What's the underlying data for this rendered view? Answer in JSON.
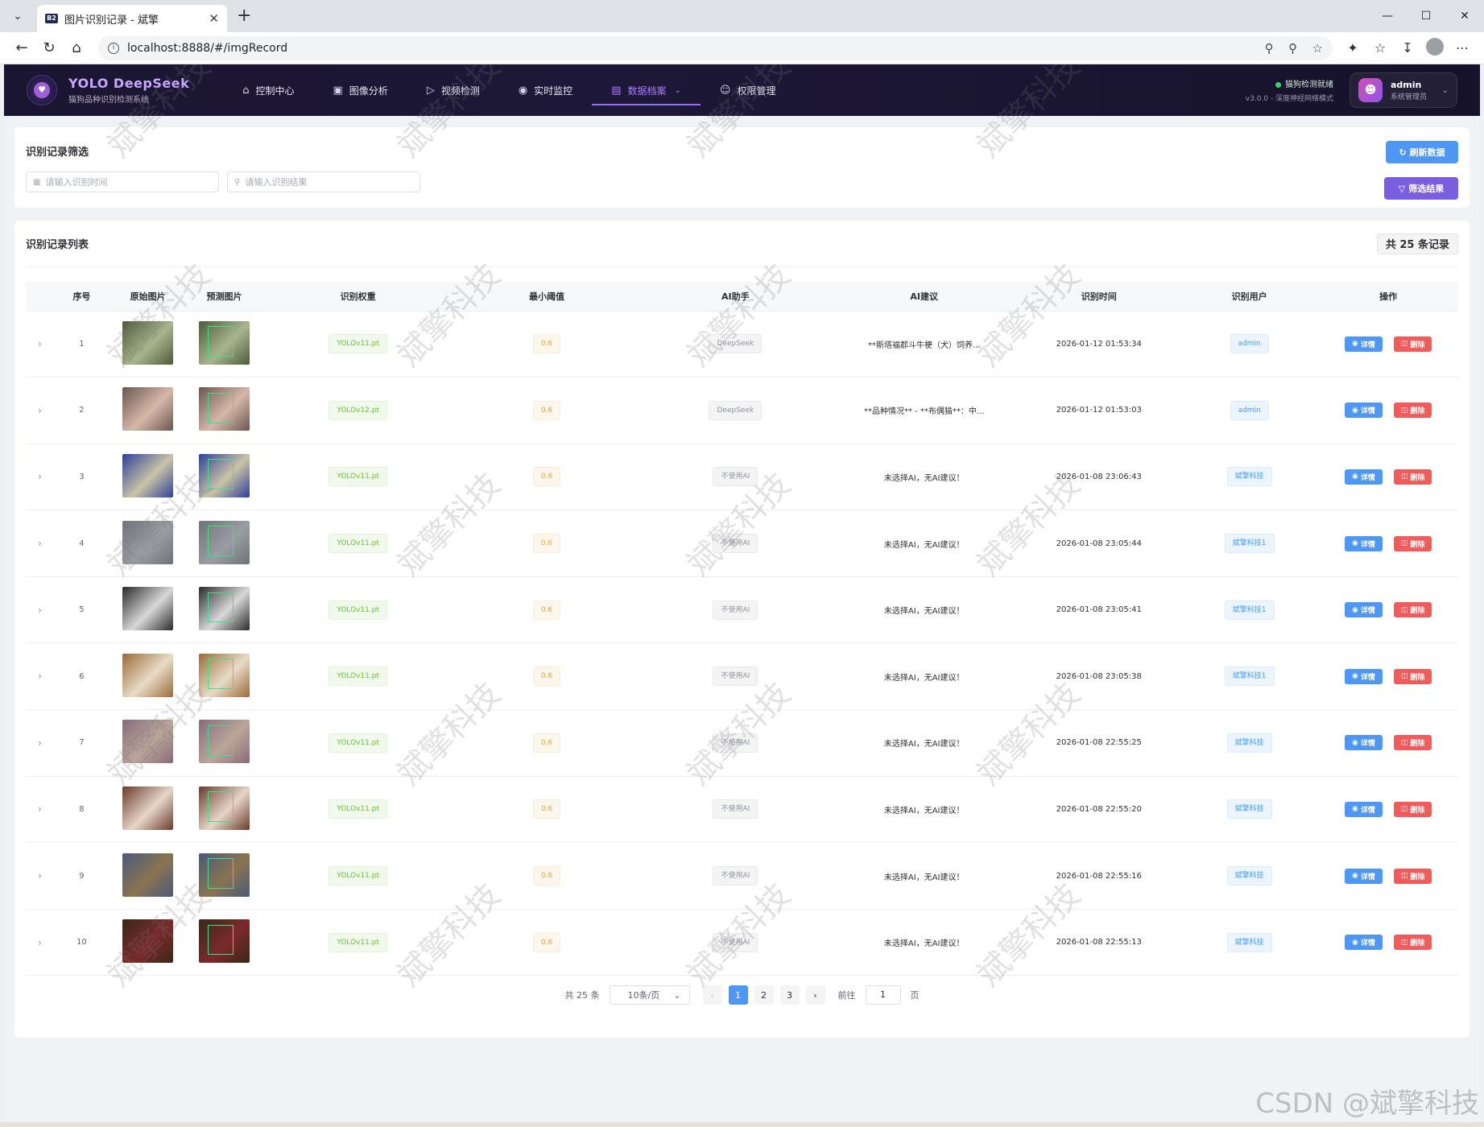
{
  "browser": {
    "tab_title": "图片识别记录 - 斌擎",
    "favicon_text": "B2",
    "url": "localhost:8888/#/imgRecord"
  },
  "header": {
    "brand_title": "YOLO DeepSeek",
    "brand_sub": "猫狗品种识别检测系统",
    "nav": [
      {
        "label": "控制中心",
        "icon": "home-icon"
      },
      {
        "label": "图像分析",
        "icon": "image-icon"
      },
      {
        "label": "视频检测",
        "icon": "play-icon"
      },
      {
        "label": "实时监控",
        "icon": "camera-icon"
      },
      {
        "label": "数据档案",
        "icon": "document-icon",
        "active": true
      },
      {
        "label": "权限管理",
        "icon": "user-icon"
      }
    ],
    "status_line1": "猫狗检测就绪",
    "status_line2": "v3.0.0 - 深度神经网络模式",
    "user_name": "admin",
    "user_role": "系统管理员"
  },
  "filter": {
    "title": "识别记录筛选",
    "time_placeholder": "请输入识别时间",
    "result_placeholder": "请输入识别结果",
    "refresh_label": "刷新数据",
    "filter_label": "筛选结果"
  },
  "list": {
    "title": "识别记录列表",
    "total_label": "共 25 条记录",
    "columns": [
      "序号",
      "原始图片",
      "预测图片",
      "识别权重",
      "最小阈值",
      "AI助手",
      "AI建议",
      "识别时间",
      "识别用户",
      "操作"
    ],
    "detail_label": "详情",
    "delete_label": "删除",
    "rows": [
      {
        "index": "1",
        "weight": "YOLOv11.pt",
        "threshold": "0.6",
        "ai": "DeepSeek",
        "advice": "**斯塔福郡斗牛梗（犬）饲养...",
        "time": "2026-01-12 01:53:34",
        "user": "admin",
        "img_a": "#4d5a3c",
        "img_b": "#a8b58c"
      },
      {
        "index": "2",
        "weight": "YOLOv12.pt",
        "threshold": "0.6",
        "ai": "DeepSeek",
        "advice": "**品种情况** - **布偶猫**：中...",
        "time": "2026-01-12 01:53:03",
        "user": "admin",
        "img_a": "#6b5650",
        "img_b": "#d6b8a8"
      },
      {
        "index": "3",
        "weight": "YOLOv11.pt",
        "threshold": "0.6",
        "ai": "不使用AI",
        "advice": "未选择AI，无AI建议！",
        "time": "2026-01-08 23:06:43",
        "user": "斌擎科技",
        "img_a": "#2f3f9a",
        "img_b": "#c9c4a6"
      },
      {
        "index": "4",
        "weight": "YOLOv11.pt",
        "threshold": "0.6",
        "ai": "不使用AI",
        "advice": "未选择AI，无AI建议！",
        "time": "2026-01-08 23:05:44",
        "user": "斌擎科技1",
        "img_a": "#6f7378",
        "img_b": "#9a9ea3"
      },
      {
        "index": "5",
        "weight": "YOLOv11.pt",
        "threshold": "0.6",
        "ai": "不使用AI",
        "advice": "未选择AI，无AI建议！",
        "time": "2026-01-08 23:05:41",
        "user": "斌擎科技1",
        "img_a": "#2a2a2a",
        "img_b": "#d8d8d8"
      },
      {
        "index": "6",
        "weight": "YOLOv11.pt",
        "threshold": "0.6",
        "ai": "不使用AI",
        "advice": "未选择AI，无AI建议！",
        "time": "2026-01-08 23:05:38",
        "user": "斌擎科技1",
        "img_a": "#9a6a38",
        "img_b": "#e8dcc8"
      },
      {
        "index": "7",
        "weight": "YOLOv11.pt",
        "threshold": "0.6",
        "ai": "不使用AI",
        "advice": "未选择AI，无AI建议！",
        "time": "2026-01-08 22:55:25",
        "user": "斌擎科技",
        "img_a": "#8a6a7a",
        "img_b": "#b9a69a"
      },
      {
        "index": "8",
        "weight": "YOLOv11.pt",
        "threshold": "0.6",
        "ai": "不使用AI",
        "advice": "未选择AI，无AI建议！",
        "time": "2026-01-08 22:55:20",
        "user": "斌擎科技",
        "img_a": "#6a3a2a",
        "img_b": "#e6d6c8"
      },
      {
        "index": "9",
        "weight": "YOLOv11.pt",
        "threshold": "0.6",
        "ai": "不使用AI",
        "advice": "未选择AI，无AI建议！",
        "time": "2026-01-08 22:55:16",
        "user": "斌擎科技",
        "img_a": "#4a5a7a",
        "img_b": "#8a7450"
      },
      {
        "index": "10",
        "weight": "YOLOv11.pt",
        "threshold": "0.6",
        "ai": "不使用AI",
        "advice": "未选择AI，无AI建议！",
        "time": "2026-01-08 22:55:13",
        "user": "斌擎科技",
        "img_a": "#3a2818",
        "img_b": "#7a2a2a"
      }
    ]
  },
  "pagination": {
    "total_label": "共 25 条",
    "page_size": "10条/页",
    "pages": [
      "1",
      "2",
      "3"
    ],
    "current_page": "1",
    "goto_label": "前往",
    "goto_value": "1",
    "page_suffix": "页"
  },
  "watermark_text": "斌擎科技",
  "csdn_text": "CSDN @斌擎科技",
  "colors": {
    "accent_blue": "#4f97f5",
    "accent_purple": "#7a5ee0",
    "danger": "#f25b5b",
    "header_bg": "#1a1530"
  }
}
